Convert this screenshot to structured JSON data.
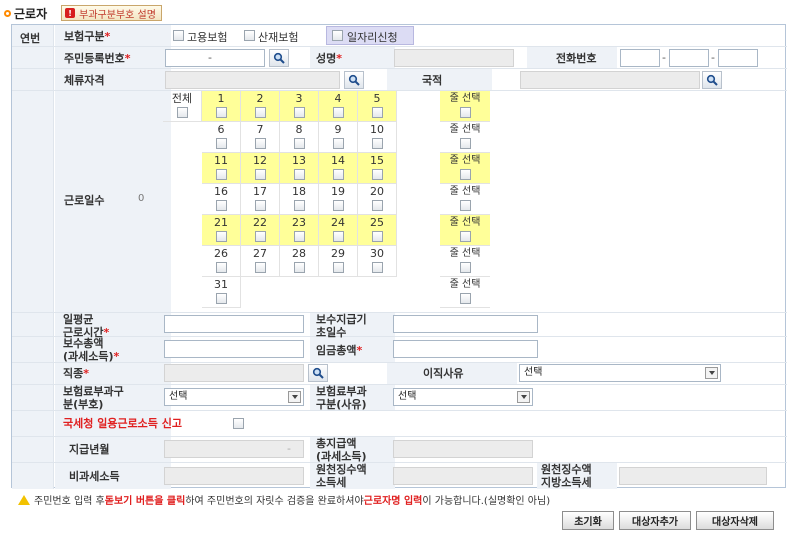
{
  "header": {
    "title": "근로자",
    "help_label": "부과구분부호 설명"
  },
  "form": {
    "row_no_label": "연번",
    "insurance": {
      "label": "보험구분",
      "options": [
        "고용보험",
        "산재보험",
        "일자리신청"
      ]
    },
    "resident_no": {
      "label": "주민등록번호",
      "dash": "-"
    },
    "name": {
      "label": "성명"
    },
    "phone": {
      "label": "전화번호",
      "dash1": "-",
      "dash2": "-"
    },
    "residence": {
      "label": "체류자격"
    },
    "nationality": {
      "label": "국적"
    },
    "work_days": {
      "label": "근로일수",
      "count": "0",
      "all_label": "전체",
      "row_select_label": "줄 선택",
      "days": [
        "1",
        "2",
        "3",
        "4",
        "5",
        "6",
        "7",
        "8",
        "9",
        "10",
        "11",
        "12",
        "13",
        "14",
        "15",
        "16",
        "17",
        "18",
        "19",
        "20",
        "21",
        "22",
        "23",
        "24",
        "25",
        "26",
        "27",
        "28",
        "29",
        "30",
        "31"
      ]
    },
    "daily_avg_hours": {
      "label": "일평균\n근로시간"
    },
    "pay_days": {
      "label": "보수지급기\n초일수"
    },
    "total_pay": {
      "label": "보수총액\n(과세소득)"
    },
    "wage_total": {
      "label": "임금총액"
    },
    "job_type": {
      "label": "직종"
    },
    "leave_reason": {
      "label": "이직사유",
      "value": "선택"
    },
    "insurance_code": {
      "label": "보험료부과구\n분(부호)",
      "value": "선택"
    },
    "insurance_reason": {
      "label": "보험료부과\n구분(사유)",
      "value": "선택"
    },
    "tax_report": {
      "label": "국세청 일용근로소득 신고"
    },
    "pay_month": {
      "label": "지급년월",
      "dash": "-"
    },
    "total_payment": {
      "label": "총지급액\n(과세소득)"
    },
    "non_taxable": {
      "label": "비과세소득"
    },
    "income_tax": {
      "label": "원천징수액\n소득세"
    },
    "local_tax": {
      "label": "원천징수액\n지방소득세"
    }
  },
  "notice": {
    "part1": "주민번호 입력 후 ",
    "part2": "돋보기 버튼을 클릭",
    "part3": "하여 주민번호의 자릿수 검증을 완료하셔야 ",
    "part4": "근로자명 입력",
    "part5": "이 가능합니다.(실명확인 아님)"
  },
  "buttons": {
    "reset": "초기화",
    "add": "대상자추가",
    "delete": "대상자삭제"
  }
}
